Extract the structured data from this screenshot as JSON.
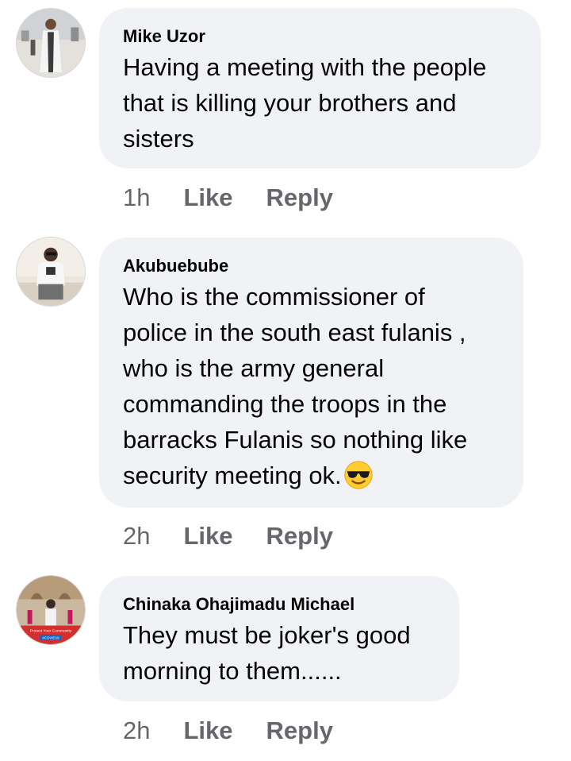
{
  "comments": [
    {
      "author": "Mike Uzor",
      "avatar_icon": "user-avatar-photo",
      "text": "Having a meeting with the people\nthat is killing your brothers and\nsisters",
      "time": "1h",
      "like_label": "Like",
      "reply_label": "Reply"
    },
    {
      "author": "Akubuebube",
      "avatar_icon": "user-avatar-photo",
      "text": "Who is the commissioner of\npolice in the south east fulanis ,\nwho is the army general\ncommanding the troops in the\nbarracks Fulanis so nothing like\nsecurity meeting ok.",
      "emoji_icon": "smiling-face-with-sunglasses-emoji",
      "time": "2h",
      "like_label": "Like",
      "reply_label": "Reply"
    },
    {
      "author": "Chinaka Ohajimadu Michael",
      "avatar_icon": "user-avatar-photo",
      "avatar_banner_lines": [
        "Protect Your Community",
        "#COVID19"
      ],
      "text": "They must be joker's good\nmorning to them......",
      "time": "2h",
      "like_label": "Like",
      "reply_label": "Reply"
    }
  ],
  "colors": {
    "bubble": "#f0f2f5",
    "meta_text": "#65676b",
    "body_text": "#050505"
  }
}
